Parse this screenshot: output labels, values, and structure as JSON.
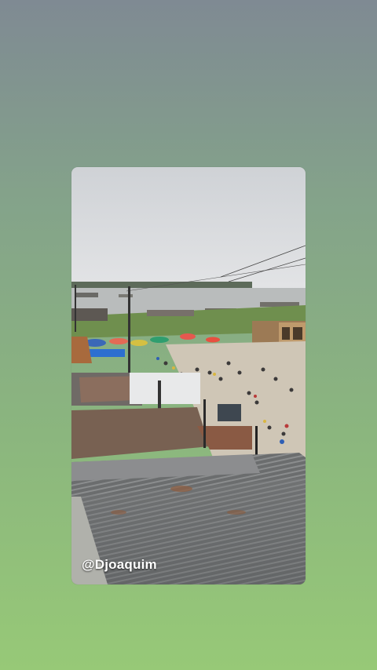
{
  "overlay": {
    "handle": "@Djoaquim"
  },
  "photo": {
    "icon": "riverside-market-photo"
  }
}
